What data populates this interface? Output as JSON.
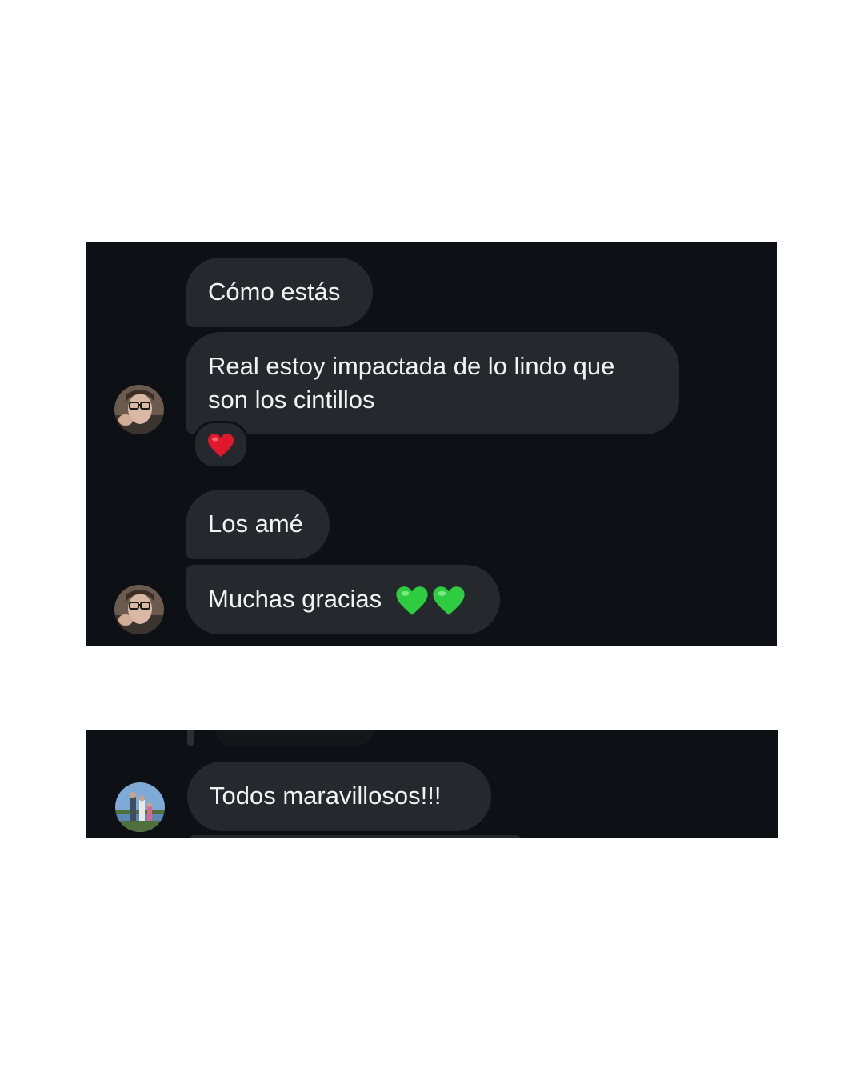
{
  "conversation_1": {
    "messages": [
      {
        "text": "Cómo estás"
      },
      {
        "text": "Real estoy impactada de lo lindo que son los cintillos",
        "reaction": "red-heart-icon"
      },
      {
        "text": "Los amé"
      },
      {
        "text": "Muchas gracias",
        "emoji": [
          "green-heart-icon",
          "green-heart-icon"
        ]
      }
    ]
  },
  "conversation_2": {
    "messages": [
      {
        "text": "Todos maravillosos!!!"
      }
    ]
  },
  "colors": {
    "background": "#0d1115",
    "bubble": "#25282c",
    "text": "#f2f2f2",
    "red_heart": "#e0182d",
    "green_heart": "#2ecc40"
  }
}
